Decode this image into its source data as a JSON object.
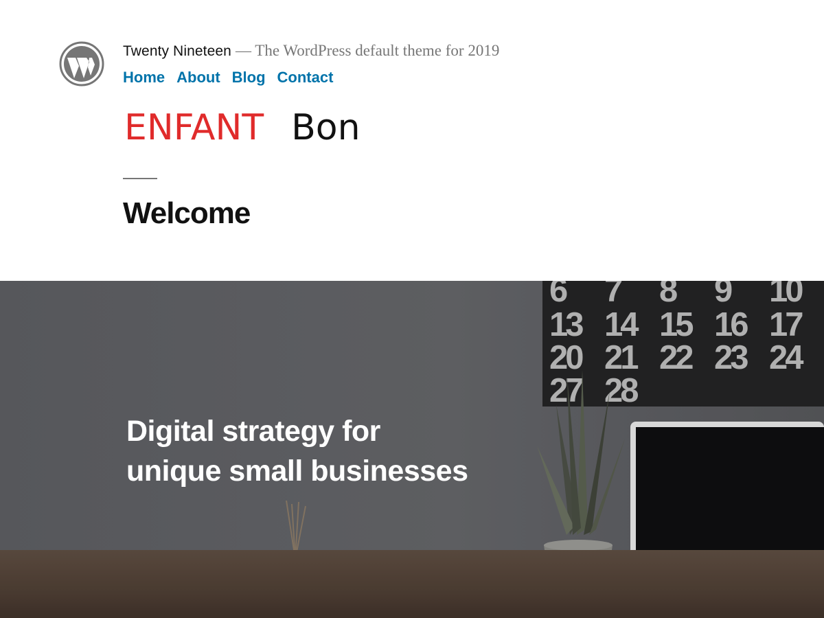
{
  "header": {
    "logo_icon": "wordpress-icon",
    "site_title": "Twenty Nineteen",
    "site_description": "— The WordPress default theme for 2019",
    "nav": [
      {
        "label": "Home"
      },
      {
        "label": "About"
      },
      {
        "label": "Blog"
      },
      {
        "label": "Contact"
      }
    ],
    "banner": {
      "word_red": "ENFANT",
      "word_black": "Bon",
      "red_color": "#e02b2b"
    }
  },
  "entry": {
    "title": "Welcome"
  },
  "hero": {
    "heading_line1": "Digital strategy for",
    "heading_line2": "unique small businesses",
    "calendar_rows": [
      [
        "6",
        "7",
        "8",
        "9",
        "10"
      ],
      [
        "13",
        "14",
        "15",
        "16",
        "17"
      ],
      [
        "20",
        "21",
        "22",
        "23",
        "24"
      ],
      [
        "27",
        "28"
      ]
    ]
  },
  "colors": {
    "link": "#0073aa",
    "text": "#111111",
    "muted": "#767676"
  }
}
